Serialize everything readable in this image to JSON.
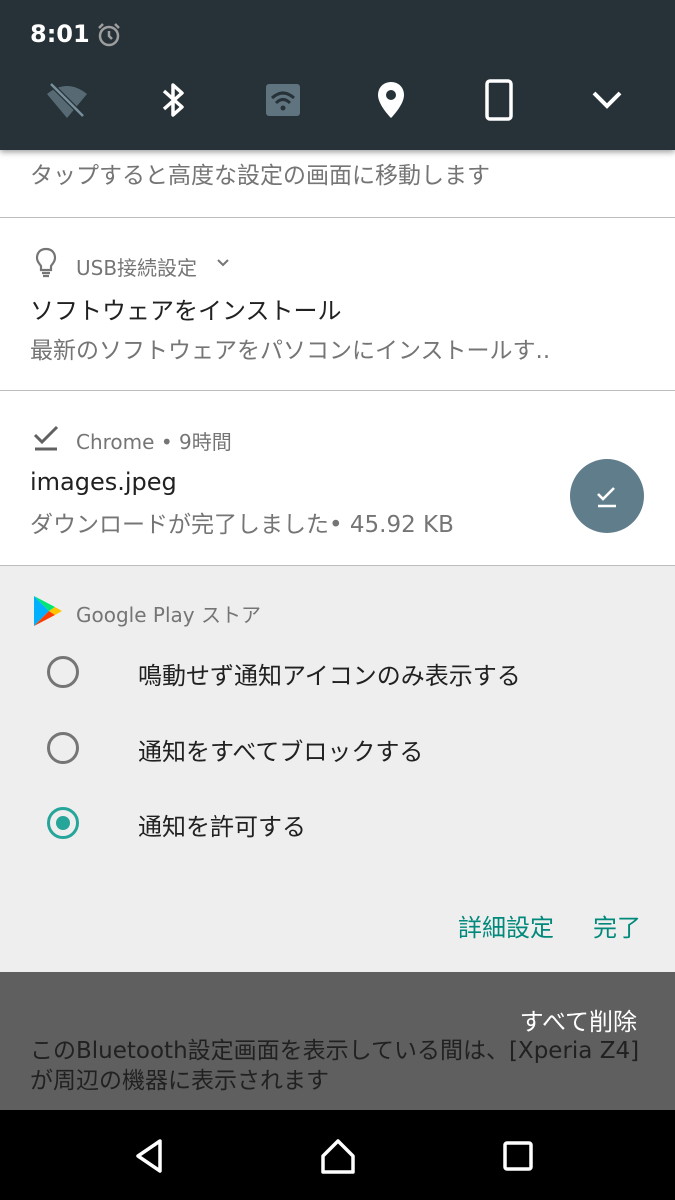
{
  "status": {
    "time": "8:01"
  },
  "quick_settings": {
    "tiles": [
      "wifi-off-icon",
      "bluetooth-icon",
      "cast-icon",
      "location-icon",
      "phone-portrait-icon",
      "expand-icon"
    ]
  },
  "notifications": {
    "advanced": {
      "text": "タップすると高度な設定の画面に移動します"
    },
    "usb": {
      "app": "USB接続設定",
      "title": "ソフトウェアをインストール",
      "text": "最新のソフトウェアをパソコンにインストールす..",
      "icon": "lightbulb-icon"
    },
    "chrome": {
      "app": "Chrome",
      "time": "9時間",
      "title": "images.jpeg",
      "text": "ダウンロードが完了しました• 45.92 KB",
      "icon": "download-done-icon"
    },
    "google_play": {
      "app": "Google Play ストア",
      "options": [
        {
          "label": "鳴動せず通知アイコンのみ表示する",
          "selected": false
        },
        {
          "label": "通知をすべてブロックする",
          "selected": false
        },
        {
          "label": "通知を許可する",
          "selected": true
        }
      ],
      "detail_label": "詳細設定",
      "done_label": "完了"
    }
  },
  "clear_all_label": "すべて削除",
  "bluetooth_text": "このBluetooth設定画面を表示している間は、[Xperia Z4]が周辺の機器に表示されます",
  "colors": {
    "accent": "#26a69a",
    "qs_bg": "#263238"
  }
}
